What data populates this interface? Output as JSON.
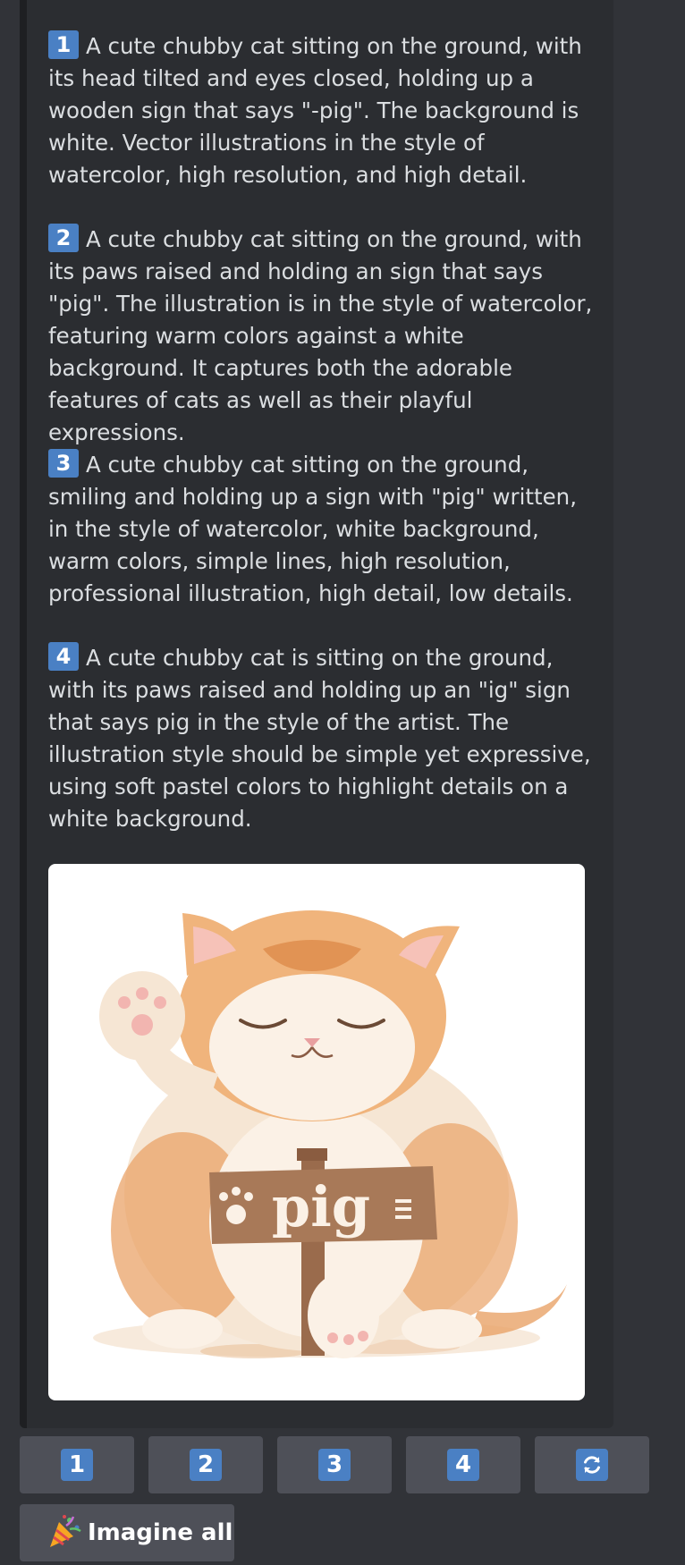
{
  "prompts": [
    {
      "number": "1",
      "text": "A cute chubby cat sitting on the ground, with its head tilted and eyes closed, holding up a wooden sign that says \"-pig\". The background is white. Vector illustrations in the style of watercolor, high resolution, and high detail."
    },
    {
      "number": "2",
      "text": "A cute chubby cat sitting on the ground, with its paws raised and holding an sign that says \"pig\". The illustration is in the style of watercolor, featuring warm colors against a white background. It captures both the adorable features of cats as well as their playful expressions."
    },
    {
      "number": "3",
      "text": "A cute chubby cat sitting on the ground, smiling and holding up a sign with \"pig\" written, in the style of watercolor, white background, warm colors, simple lines, high resolution, professional illustration, high detail, low details."
    },
    {
      "number": "4",
      "text": "A cute chubby cat is sitting on the ground, with its paws raised and holding up an \"ig\" sign that says pig in the style of the artist. The illustration style should be simple yet expressive, using soft pastel colors to highlight details on a white background."
    }
  ],
  "image": {
    "sign_text": "pig"
  },
  "buttons": [
    {
      "label": "1"
    },
    {
      "label": "2"
    },
    {
      "label": "3"
    },
    {
      "label": "4"
    },
    {
      "icon": "refresh-icon"
    }
  ],
  "imagine_all": {
    "icon": "party-popper-icon",
    "label": "Imagine all"
  },
  "colors": {
    "background": "#313338",
    "embed": "#2b2d31",
    "button": "#4e5058",
    "badge": "#4a80c4",
    "text": "#dbdee1"
  }
}
